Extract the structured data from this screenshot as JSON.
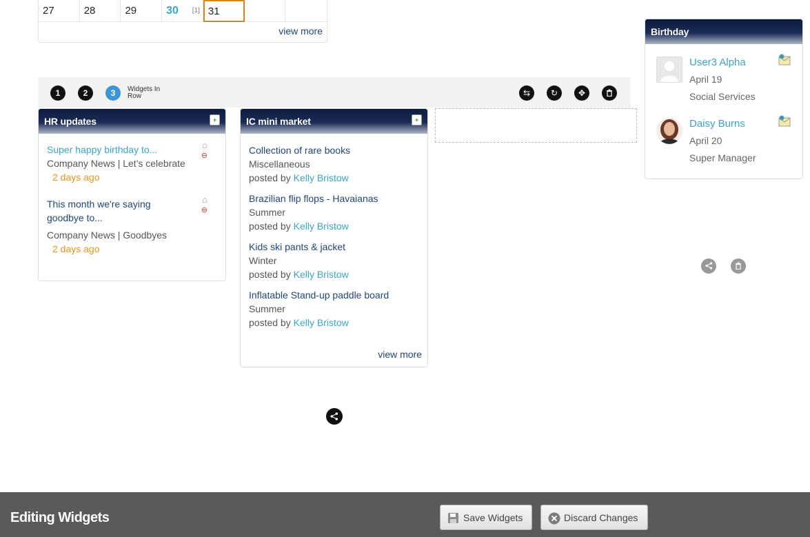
{
  "calendar": {
    "days": [
      {
        "num": "27",
        "count": "",
        "state": "normal"
      },
      {
        "num": "28",
        "count": "",
        "state": "normal"
      },
      {
        "num": "29",
        "count": "",
        "state": "normal"
      },
      {
        "num": "30",
        "count": "[1]",
        "state": "has-event"
      },
      {
        "num": "31",
        "count": "",
        "state": "today"
      },
      {
        "num": "",
        "count": "",
        "state": "normal"
      },
      {
        "num": "",
        "count": "",
        "state": "normal"
      }
    ],
    "view_more": "view more"
  },
  "row_toolbar": {
    "buttons": [
      "1",
      "2",
      "3"
    ],
    "active": "3",
    "label": "Widgets In Row",
    "tools": [
      "swap-icon",
      "redo-icon",
      "move-icon",
      "trash-icon"
    ]
  },
  "hr_updates": {
    "title": "HR updates",
    "items": [
      {
        "title": "Super happy birthday to...",
        "title_color": "#3ba5c9",
        "meta": "Company News | Let's celebrate",
        "ago": "2 days ago"
      },
      {
        "title": "This month we're saying goodbye to...",
        "title_color": "#1f4677",
        "meta": "Company News | Goodbyes",
        "ago": "2 days ago"
      }
    ]
  },
  "mini_market": {
    "title": "IC mini market",
    "posted_by_prefix": "posted by",
    "items": [
      {
        "title": "Collection of rare books",
        "category": "Miscellaneous",
        "author": "Kelly Bristow"
      },
      {
        "title": "Brazilian flip flops - Havaianas",
        "category": "Summer",
        "author": "Kelly Bristow"
      },
      {
        "title": "Kids ski pants & jacket",
        "category": "Winter",
        "author": "Kelly Bristow"
      },
      {
        "title": "Inflatable Stand-up paddle board",
        "category": "Summer",
        "author": "Kelly Bristow"
      }
    ],
    "view_more": "view more"
  },
  "birthday": {
    "title": "Birthday",
    "people": [
      {
        "name": "User3 Alpha",
        "date": "April 19",
        "role": "Social Services",
        "avatar": "placeholder"
      },
      {
        "name": "Daisy Burns",
        "date": "April 20",
        "role": "Super Manager",
        "avatar": "photo"
      }
    ]
  },
  "bottom_bar": {
    "title": "Editing Widgets",
    "save_label": "Save Widgets",
    "discard_label": "Discard Changes"
  },
  "colors": {
    "accent": "#3b95d6",
    "link": "#3ba5c9",
    "dark_link": "#1f4677",
    "orange": "#e8941a",
    "header_dark": "#0c1c40"
  }
}
